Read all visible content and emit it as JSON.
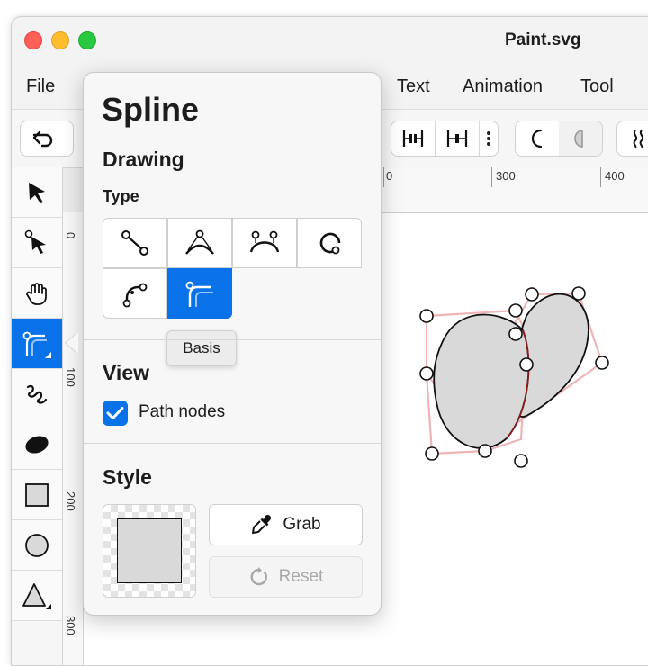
{
  "window": {
    "title": "Paint.svg"
  },
  "menubar": {
    "items": [
      "File",
      "Text",
      "Animation",
      "Tool"
    ]
  },
  "rulers": {
    "h_labels": [
      "0",
      "300",
      "400"
    ],
    "v_labels": [
      "0",
      "100",
      "200",
      "300"
    ]
  },
  "popover": {
    "title": "Spline",
    "drawing": {
      "heading": "Drawing",
      "type_label": "Type",
      "selected_type": "Basis",
      "tooltip": "Basis"
    },
    "view": {
      "heading": "View",
      "path_nodes_label": "Path nodes",
      "path_nodes_checked": true
    },
    "style": {
      "heading": "Style",
      "fill_color": "#d9d9d9",
      "grab_label": "Grab",
      "reset_label": "Reset"
    }
  },
  "colors": {
    "accent": "#0a72e8",
    "control_polygon": "#f0b4b4",
    "shape_fill": "#d9d9d9"
  },
  "left_tools": [
    "arrow-select-icon",
    "direct-select-icon",
    "hand-icon",
    "spline-icon",
    "freehand-icon",
    "ellipse-filled-icon",
    "rectangle-icon",
    "circle-icon",
    "triangle-icon"
  ]
}
